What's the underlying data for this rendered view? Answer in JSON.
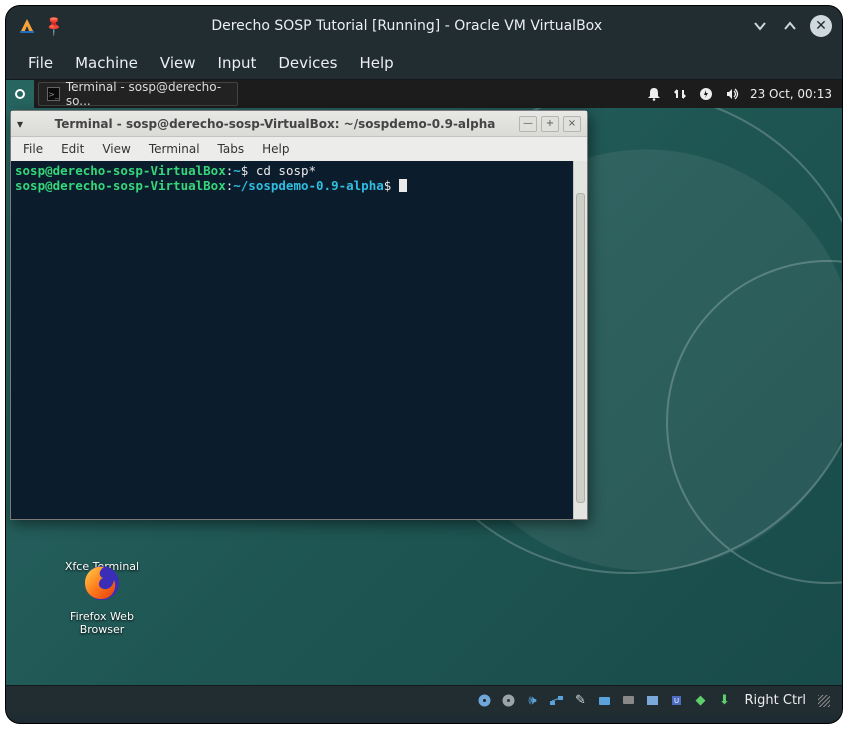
{
  "vb": {
    "title": "Derecho SOSP Tutorial [Running] - Oracle VM VirtualBox",
    "menu": [
      "File",
      "Machine",
      "View",
      "Input",
      "Devices",
      "Help"
    ],
    "host_key": "Right Ctrl"
  },
  "panel": {
    "task_label": "Terminal - sosp@derecho-so...",
    "clock": "23 Oct, 00:13"
  },
  "desktop": {
    "icon1_label": "Xfce Terminal",
    "icon2_label": "Firefox Web Browser"
  },
  "terminal": {
    "title": "Terminal - sosp@derecho-sosp-VirtualBox: ~/sospdemo-0.9-alpha",
    "menu": [
      "File",
      "Edit",
      "View",
      "Terminal",
      "Tabs",
      "Help"
    ],
    "line1": {
      "user": "sosp@derecho-sosp-VirtualBox",
      "sep": ":",
      "path": "~",
      "prompt": "$ ",
      "cmd": "cd sosp*"
    },
    "line2": {
      "user": "sosp@derecho-sosp-VirtualBox",
      "sep": ":",
      "path": "~/sospdemo-0.9-alpha",
      "prompt": "$ "
    }
  }
}
